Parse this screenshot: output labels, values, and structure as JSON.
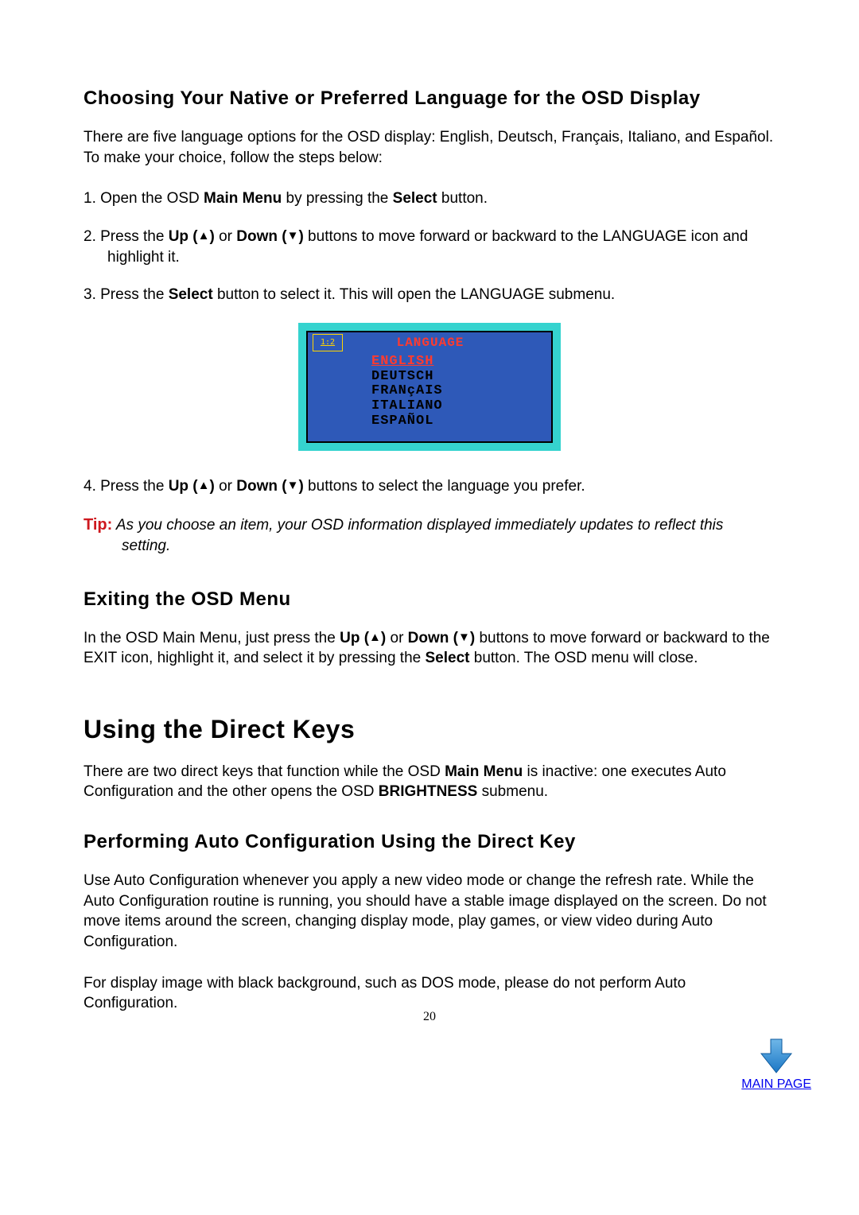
{
  "heading_language": "Choosing Your Native or Preferred Language for the OSD Display",
  "intro_language": "There are five language options for the OSD display: English, Deutsch, Français, Italiano, and Español. To make your choice, follow the steps below:",
  "step1_num": "1.",
  "step1_a": "  Open the OSD ",
  "step1_b": "Main Menu",
  "step1_c": " by pressing the ",
  "step1_d": "Select",
  "step1_e": " button.",
  "step2_num": "2.",
  "step2_a": "  Press the ",
  "step2_b": "Up (",
  "step2_c": ")",
  "step2_d": " or ",
  "step2_e": "Down (",
  "step2_f": ")",
  "step2_g": " buttons to move forward or backward to the LANGUAGE icon and highlight it.",
  "step3_num": "3.",
  "step3_a": "  Press the ",
  "step3_b": "Select",
  "step3_c": " button to select it. This will open the LANGUAGE submenu.",
  "step4_num": "4.",
  "step4_a": "  Press the ",
  "step4_b": "Up (",
  "step4_c": ")",
  "step4_d": " or ",
  "step4_e": "Down (",
  "step4_f": ")",
  "step4_g": " buttons to select the language you prefer.",
  "tip_label": "Tip:",
  "tip_text": "  As you choose an item, your OSD information displayed immediately updates to reflect this setting.",
  "heading_exit": "Exiting the OSD Menu",
  "exit_a": "In the OSD Main Menu, just press the ",
  "exit_b": "Up (",
  "exit_c": ")",
  "exit_d": " or ",
  "exit_e": "Down (",
  "exit_f": ")",
  "exit_g": " buttons to move forward or backward to the EXIT icon, highlight it, and select it by pressing the ",
  "exit_h": "Select",
  "exit_i": " button. The OSD menu will close.",
  "heading_direct": "Using the Direct Keys",
  "direct_a": "There are two direct keys that function while the OSD ",
  "direct_b": "Main Menu",
  "direct_c": " is inactive: one executes Auto Configuration and the other opens the OSD ",
  "direct_d": "BRIGHTNESS",
  "direct_e": " submenu.",
  "heading_auto": "Performing Auto Configuration Using the Direct Key",
  "auto_p1": "Use Auto Configuration whenever you apply a new video mode or change the refresh rate. While the Auto Configuration routine is running, you should have a stable image displayed on the screen. Do not move items around the screen, changing display mode, play games, or view video during Auto Configuration.",
  "auto_p2": "For display image with black background, such as DOS mode, please do not perform Auto Configuration.",
  "osd_badge": "1:2",
  "osd_title": "LANGUAGE",
  "osd_items": {
    "i0": "ENGLISH",
    "i1": "DEUTSCH",
    "i2": "FRANçAIS",
    "i3": "ITALIANO",
    "i4": "ESPAÑOL"
  },
  "page_number": "20",
  "mainpage_label": "MAIN PAGE"
}
